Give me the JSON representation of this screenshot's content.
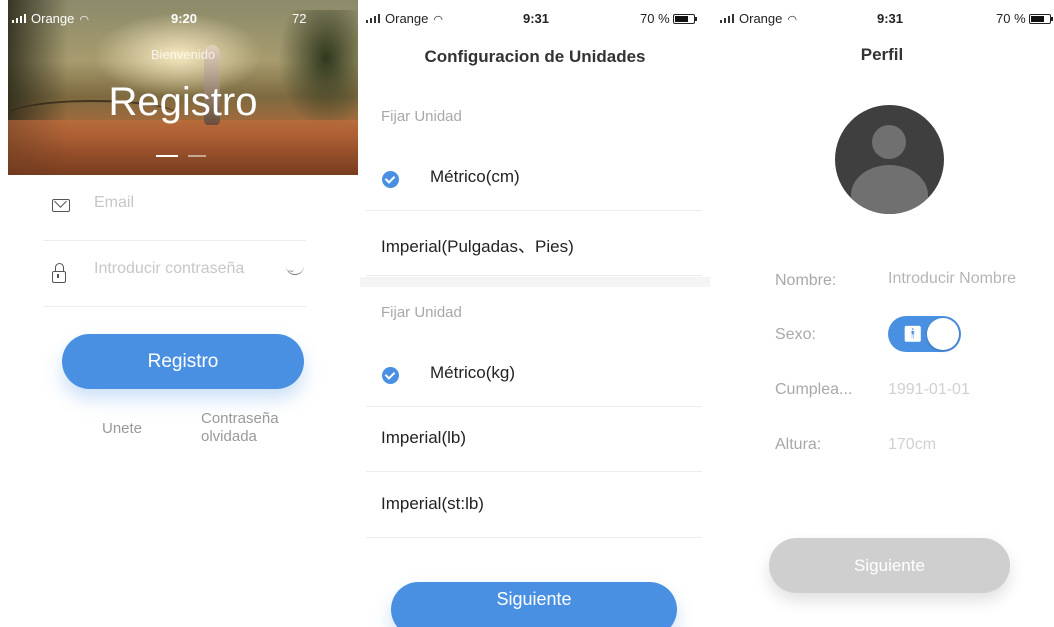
{
  "colors": {
    "accent": "#4a90e2",
    "disabled": "#cfcfcf"
  },
  "screen1": {
    "statusbar": {
      "carrier": "Orange",
      "time": "9:20",
      "battery": "72"
    },
    "hero": {
      "welcome": "Bienvenido",
      "title": "Registro"
    },
    "email": {
      "placeholder": "Email",
      "icon": "envelope-icon"
    },
    "password": {
      "placeholder": "Introducir contraseña",
      "icon": "lock-icon",
      "toggle_icon": "eye-closed-icon"
    },
    "submit_label": "Registro",
    "join_link": "Unete",
    "forgot_link_line1": "Contraseña",
    "forgot_link_line2": "olvidada"
  },
  "screen2": {
    "statusbar": {
      "carrier": "Orange",
      "time": "9:31",
      "battery": "70 %"
    },
    "title": "Configuracion de Unidades",
    "height_section": {
      "label": "Fijar Unidad",
      "options": [
        "Métrico(cm)",
        "Imperial(Pulgadas、Pies)"
      ],
      "selected": "Métrico(cm)"
    },
    "weight_section": {
      "label": "Fijar Unidad",
      "options": [
        "Métrico(kg)",
        "Imperial(lb)",
        "Imperial(st:lb)"
      ],
      "selected": "Métrico(kg)"
    },
    "next_label": "Siguiente"
  },
  "screen3": {
    "statusbar": {
      "carrier": "Orange",
      "time": "9:31",
      "battery": "70 %"
    },
    "title": "Perfil",
    "name": {
      "label": "Nombre:",
      "placeholder": "Introducir Nombre"
    },
    "sex": {
      "label": "Sexo:",
      "value": "male"
    },
    "birthday": {
      "label": "Cumplea...",
      "value": "1991-01-01"
    },
    "height": {
      "label": "Altura:",
      "value": "170cm"
    },
    "next_label": "Siguiente"
  }
}
